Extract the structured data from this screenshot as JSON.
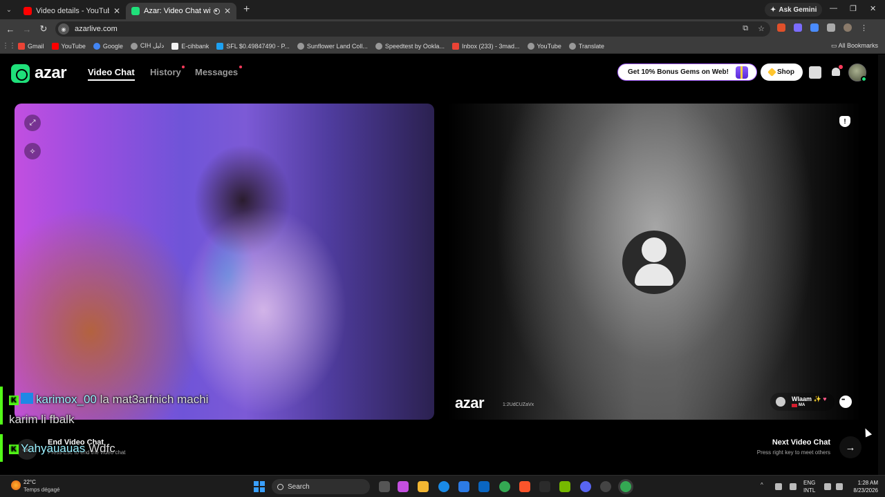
{
  "browser": {
    "tabs": [
      {
        "title": "Video details - YouTube Studio",
        "favicon_color": "#ff0000",
        "active": false
      },
      {
        "title": "Azar: Video Chat with New",
        "favicon_color": "#1fe07a",
        "active": true
      }
    ],
    "new_tab_label": "+",
    "ask_gemini": "Ask Gemini",
    "url": "azarlive.com",
    "bookmarks": [
      {
        "label": "Gmail",
        "color": "#ea4335"
      },
      {
        "label": "YouTube",
        "color": "#ff0000"
      },
      {
        "label": "Google",
        "color": "#4285f4"
      },
      {
        "label": "CIH دليل",
        "color": "#999999"
      },
      {
        "label": "E-cihbank",
        "color": "#f2f2f2"
      },
      {
        "label": "SFL $0.49847490 - P...",
        "color": "#1da1f2"
      },
      {
        "label": "Sunflower Land Coll...",
        "color": "#999999"
      },
      {
        "label": "Speedtest by Ookla...",
        "color": "#999999"
      },
      {
        "label": "Inbox (233) - 3mad...",
        "color": "#ea4335"
      },
      {
        "label": "YouTube",
        "color": "#999999"
      },
      {
        "label": "Translate",
        "color": "#999999"
      }
    ],
    "all_bookmarks": "All Bookmarks"
  },
  "header": {
    "logo_text": "azar",
    "nav": {
      "video_chat": "Video Chat",
      "history": "History",
      "messages": "Messages"
    },
    "promo_label": "Get 10% Bonus Gems on Web!",
    "shop_label": "Shop",
    "accent_color": "#1fe07a"
  },
  "remote": {
    "logo_text": "azar",
    "session_id": "1:2UdCUZaVx",
    "peer_name": "Wlaam ✨",
    "peer_heart": "♥",
    "peer_country": "MA"
  },
  "chat_overlay": [
    {
      "user": "karimox_00",
      "message": "la mat3arfnich machi",
      "continuation": "karim li fbalk"
    },
    {
      "user": "Yahyauauas",
      "message": "Wdfc"
    }
  ],
  "controls": {
    "end_label": "End Video Chat",
    "end_sub": "Press Esc to end the video chat",
    "esc_key": "esc",
    "next_label": "Next Video Chat",
    "next_sub": "Press right key to meet others",
    "next_arrow": "→"
  },
  "taskbar": {
    "temperature": "22°C",
    "weather": "Temps dégagé",
    "search_label": "Search",
    "language_top": "ENG",
    "language_bottom": "INTL",
    "time": "1:28 AM",
    "date": "8/23/2026"
  }
}
